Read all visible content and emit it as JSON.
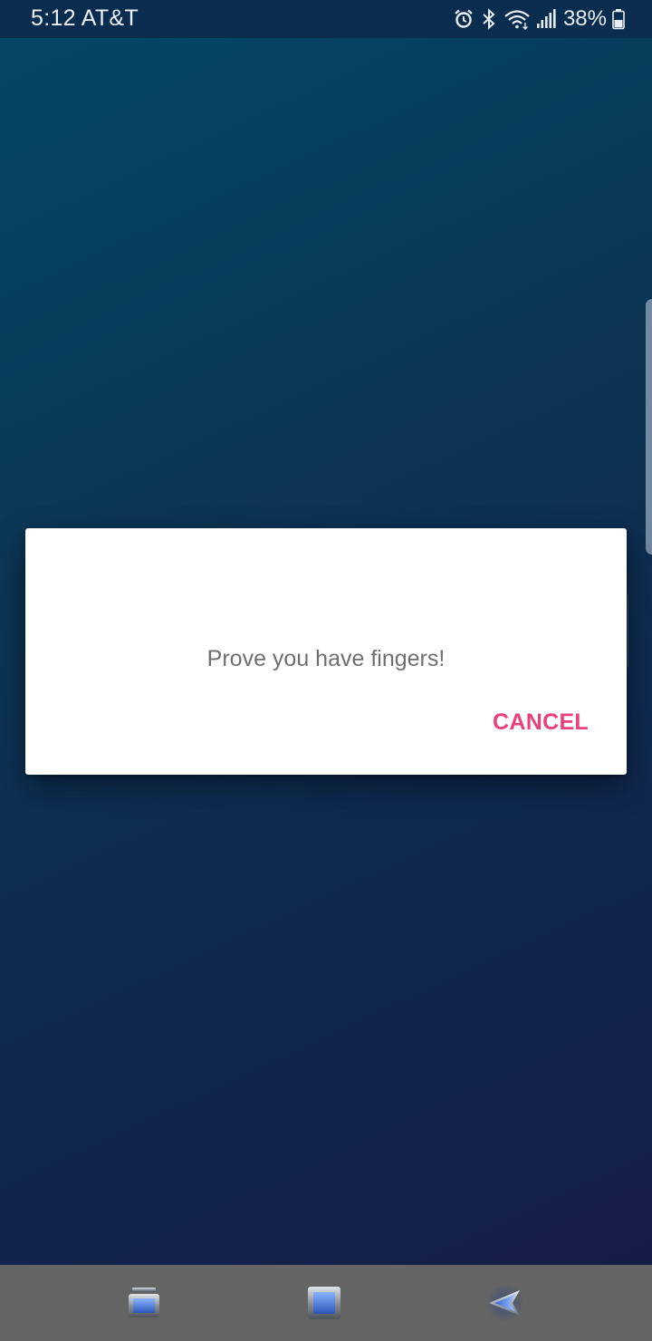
{
  "status_bar": {
    "time_carrier": "5:12 AT&T",
    "battery_percent": "38%",
    "icons": [
      "alarm-icon",
      "bluetooth-icon",
      "wifi-icon",
      "signal-icon",
      "battery-icon"
    ]
  },
  "dialog": {
    "message": "Prove you have fingers!",
    "cancel_label": "CANCEL"
  },
  "nav_bar": {
    "buttons": [
      "recents-icon",
      "home-icon",
      "back-icon"
    ]
  },
  "colors": {
    "accent": "#ec407a",
    "background_top": "#034866",
    "background_bottom": "#151b45",
    "nav_bar": "#646464"
  }
}
